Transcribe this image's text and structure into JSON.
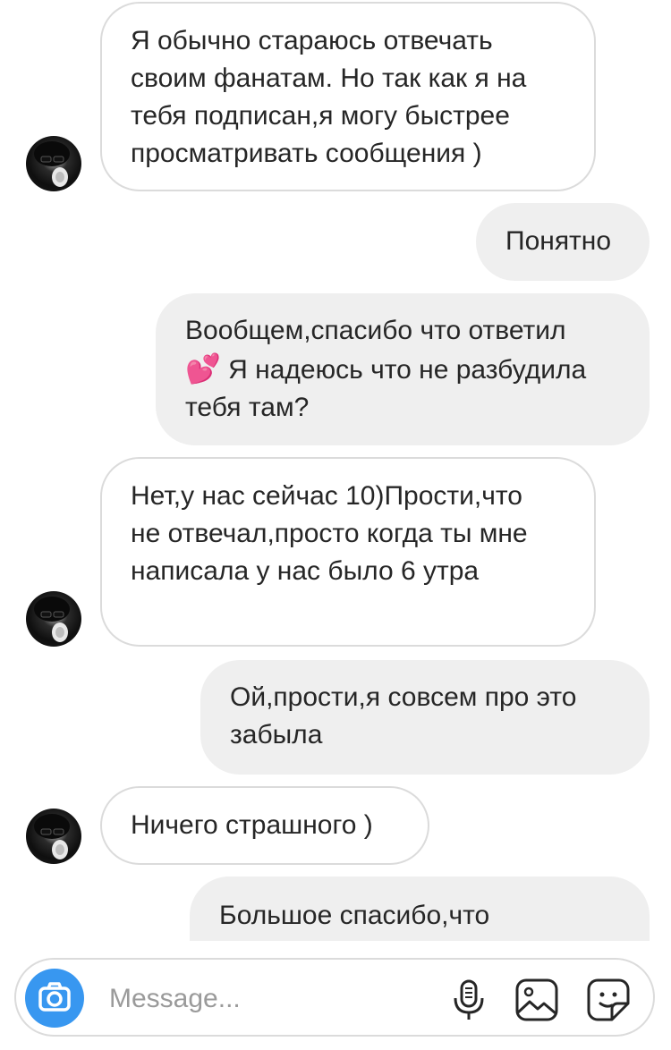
{
  "messages": [
    {
      "side": "incoming",
      "text": "Я обычно стараюсь отвечать своим фанатам. Но так как я на тебя подписан,я могу быстрее просматривать сообщения )"
    },
    {
      "side": "outgoing",
      "text": "Понятно"
    },
    {
      "side": "outgoing",
      "line1": "Вообщем,спасибо что ответил",
      "emoji": "💕",
      "line2": " Я надеюсь что не разбудила тебя там?"
    },
    {
      "side": "incoming",
      "text": "Нет,у нас сейчас 10)Прости,что не отвечал,просто когда ты мне написала у нас было 6 утра"
    },
    {
      "side": "outgoing",
      "text": "Ой,прости,я совсем про это забыла"
    },
    {
      "side": "incoming",
      "text": "Ничего страшного )"
    },
    {
      "side": "outgoing",
      "text": "Большое спасибо,что"
    }
  ],
  "composer": {
    "placeholder": "Message...",
    "camera_icon": "camera-icon",
    "icons": [
      "microphone-icon",
      "gallery-icon",
      "sticker-icon"
    ]
  },
  "colors": {
    "incoming_bg": "#ffffff",
    "incoming_border": "#dbdbdb",
    "outgoing_bg": "#efefef",
    "camera_accent": "#3897f0",
    "text": "#262626",
    "placeholder": "#9a9a9a"
  }
}
